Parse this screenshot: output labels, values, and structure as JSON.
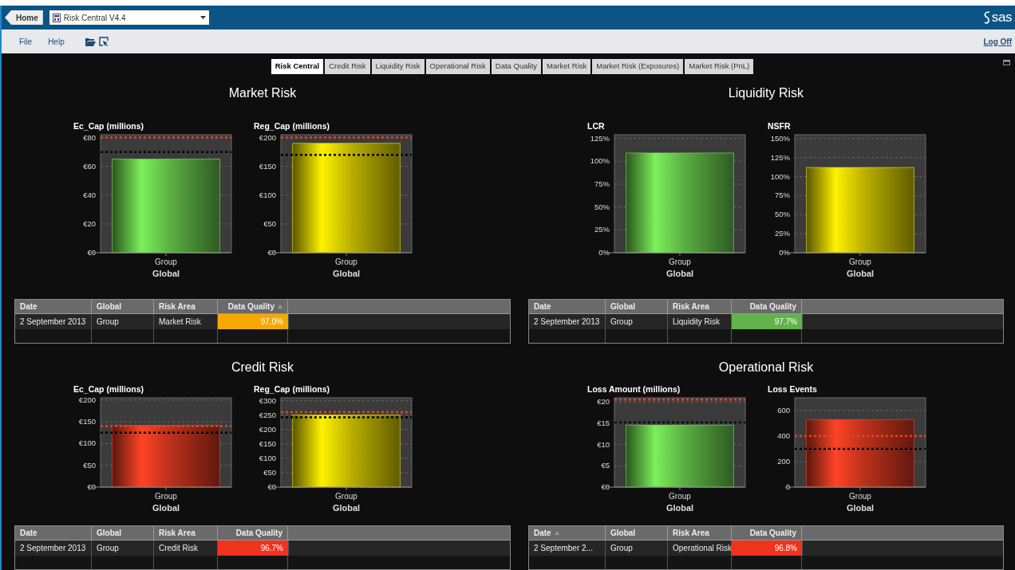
{
  "header": {
    "home": "Home",
    "app_selector": "Risk Central V4.4",
    "logo": "sas"
  },
  "menu": {
    "items": [
      "File",
      "Help"
    ],
    "log_off": "Log Off"
  },
  "tabs": [
    {
      "label": "Risk Central",
      "selected": true
    },
    {
      "label": "Credit Risk",
      "selected": false
    },
    {
      "label": "Liquidity Risk",
      "selected": false
    },
    {
      "label": "Operational Risk",
      "selected": false
    },
    {
      "label": "Data Quality",
      "selected": false
    },
    {
      "label": "Market Risk",
      "selected": false
    },
    {
      "label": "Market Risk (Exposures)",
      "selected": false
    },
    {
      "label": "Market Risk (PnL)",
      "selected": false
    }
  ],
  "panels": [
    {
      "title": "Market Risk",
      "charts": [
        {
          "chart_data": {
            "type": "bar",
            "title": "Ec_Cap (millions)",
            "xlabel": "Global",
            "categories": [
              "Group"
            ],
            "series": [
              {
                "color": "#7cf05a",
                "values": [
                  65
                ]
              }
            ],
            "ylim": [
              0,
              82
            ],
            "yticks": [
              {
                "value": 0,
                "label": "€0"
              },
              {
                "value": 20,
                "label": "€20"
              },
              {
                "value": 40,
                "label": "€40"
              },
              {
                "value": 60,
                "label": "€60"
              },
              {
                "value": 80,
                "label": "€80"
              }
            ],
            "grid": true,
            "ref_lines": [
              {
                "axis": "y",
                "value": 80,
                "color": "#e8432c"
              },
              {
                "axis": "y",
                "value": 70,
                "color": "#000000"
              }
            ]
          }
        },
        {
          "chart_data": {
            "type": "bar",
            "title": "Reg_Cap (millions)",
            "xlabel": "Global",
            "categories": [
              "Group"
            ],
            "series": [
              {
                "color": "#fff200",
                "values": [
                  190
                ]
              }
            ],
            "ylim": [
              0,
              205
            ],
            "yticks": [
              {
                "value": 0,
                "label": "€0"
              },
              {
                "value": 50,
                "label": "€50"
              },
              {
                "value": 100,
                "label": "€100"
              },
              {
                "value": 150,
                "label": "€150"
              },
              {
                "value": 200,
                "label": "€200"
              }
            ],
            "grid": true,
            "ref_lines": [
              {
                "axis": "y",
                "value": 200,
                "color": "#e8432c"
              },
              {
                "axis": "y",
                "value": 170,
                "color": "#000000"
              }
            ]
          }
        }
      ],
      "table": {
        "columns": [
          {
            "label": "Date",
            "kind": "text",
            "sorted": false
          },
          {
            "label": "Global",
            "kind": "text",
            "sorted": false
          },
          {
            "label": "Risk Area",
            "kind": "text",
            "sorted": false
          },
          {
            "label": "Data Quality",
            "kind": "quality",
            "sorted": true
          }
        ],
        "rows": [
          {
            "date": "2 September 2013",
            "global": "Group",
            "area": "Market Risk",
            "quality": "97.0%",
            "color": "#f5a800"
          }
        ]
      }
    },
    {
      "title": "Liquidity Risk",
      "charts": [
        {
          "chart_data": {
            "type": "bar",
            "title": "LCR",
            "xlabel": "Global",
            "categories": [
              "Group"
            ],
            "series": [
              {
                "color": "#7cf05a",
                "values": [
                  109
                ]
              }
            ],
            "ylim": [
              0,
              129
            ],
            "yticks": [
              {
                "value": 0,
                "label": "0%"
              },
              {
                "value": 25,
                "label": "25%"
              },
              {
                "value": 50,
                "label": "50%"
              },
              {
                "value": 75,
                "label": "75%"
              },
              {
                "value": 100,
                "label": "100%"
              },
              {
                "value": 125,
                "label": "125%"
              }
            ],
            "grid": true
          }
        },
        {
          "chart_data": {
            "type": "bar",
            "title": "NSFR",
            "xlabel": "Global",
            "categories": [
              "Group"
            ],
            "series": [
              {
                "color": "#fff200",
                "values": [
                  112
                ]
              }
            ],
            "ylim": [
              0,
              155
            ],
            "yticks": [
              {
                "value": 0,
                "label": "0%"
              },
              {
                "value": 25,
                "label": "25%"
              },
              {
                "value": 50,
                "label": "50%"
              },
              {
                "value": 75,
                "label": "75%"
              },
              {
                "value": 100,
                "label": "100%"
              },
              {
                "value": 125,
                "label": "125%"
              },
              {
                "value": 150,
                "label": "150%"
              }
            ],
            "grid": true
          }
        }
      ],
      "table": {
        "columns": [
          {
            "label": "Date",
            "kind": "text",
            "sorted": false
          },
          {
            "label": "Global",
            "kind": "text",
            "sorted": false
          },
          {
            "label": "Risk Area",
            "kind": "text",
            "sorted": false
          },
          {
            "label": "Data Quality",
            "kind": "quality",
            "sorted": false
          }
        ],
        "rows": [
          {
            "date": "2 September 2013",
            "global": "Group",
            "area": "Liquidity Risk",
            "quality": "97.7%",
            "color": "#62b34a"
          }
        ]
      }
    },
    {
      "title": "Credit Risk",
      "charts": [
        {
          "chart_data": {
            "type": "bar",
            "title": "Ec_Cap (millions)",
            "xlabel": "Global",
            "categories": [
              "Group"
            ],
            "series": [
              {
                "color": "#ff4326",
                "values": [
                  142
                ]
              }
            ],
            "ylim": [
              0,
              205
            ],
            "yticks": [
              {
                "value": 0,
                "label": "€0"
              },
              {
                "value": 50,
                "label": "€50"
              },
              {
                "value": 100,
                "label": "€100"
              },
              {
                "value": 150,
                "label": "€150"
              },
              {
                "value": 200,
                "label": "€200"
              }
            ],
            "grid": true,
            "ref_lines": [
              {
                "axis": "y",
                "value": 140,
                "color": "#e8432c"
              },
              {
                "axis": "y",
                "value": 125,
                "color": "#000000"
              }
            ]
          }
        },
        {
          "chart_data": {
            "type": "bar",
            "title": "Reg_Cap (millions)",
            "xlabel": "Global",
            "categories": [
              "Group"
            ],
            "series": [
              {
                "color": "#fff200",
                "values": [
                  250
                ]
              }
            ],
            "ylim": [
              0,
              310
            ],
            "yticks": [
              {
                "value": 0,
                "label": "€0"
              },
              {
                "value": 50,
                "label": "€50"
              },
              {
                "value": 100,
                "label": "€100"
              },
              {
                "value": 150,
                "label": "€150"
              },
              {
                "value": 200,
                "label": "€200"
              },
              {
                "value": 250,
                "label": "€250"
              },
              {
                "value": 300,
                "label": "€300"
              }
            ],
            "grid": true,
            "ref_lines": [
              {
                "axis": "y",
                "value": 260,
                "color": "#e8432c"
              },
              {
                "axis": "y",
                "value": 242,
                "color": "#000000"
              }
            ]
          }
        }
      ],
      "table": {
        "columns": [
          {
            "label": "Date",
            "kind": "text",
            "sorted": false
          },
          {
            "label": "Global",
            "kind": "text",
            "sorted": false
          },
          {
            "label": "Risk Area",
            "kind": "text",
            "sorted": false
          },
          {
            "label": "Data Quality",
            "kind": "quality",
            "sorted": false
          }
        ],
        "rows": [
          {
            "date": "2 September 2013",
            "global": "Group",
            "area": "Credit Risk",
            "quality": "96.7%",
            "color": "#f0321e"
          }
        ]
      }
    },
    {
      "title": "Operational Risk",
      "charts": [
        {
          "chart_data": {
            "type": "bar",
            "title": "Loss Amount (millions)",
            "xlabel": "Global",
            "categories": [
              "Group"
            ],
            "series": [
              {
                "color": "#7cf05a",
                "values": [
                  14.6
                ]
              }
            ],
            "ylim": [
              0,
              21
            ],
            "yticks": [
              {
                "value": 0,
                "label": "€0"
              },
              {
                "value": 5,
                "label": "€5"
              },
              {
                "value": 10,
                "label": "€10"
              },
              {
                "value": 15,
                "label": "€15"
              },
              {
                "value": 20,
                "label": "€20"
              }
            ],
            "grid": true,
            "ref_lines": [
              {
                "axis": "y",
                "value": 20.6,
                "color": "#e8432c"
              },
              {
                "axis": "y",
                "value": 15.2,
                "color": "#000000"
              }
            ]
          }
        },
        {
          "chart_data": {
            "type": "bar",
            "title": "Loss Events",
            "xlabel": "Global",
            "categories": [
              "Group"
            ],
            "series": [
              {
                "color": "#ff4326",
                "values": [
                  530
                ]
              }
            ],
            "ylim": [
              0,
              700
            ],
            "yticks": [
              0,
              200,
              400,
              600
            ],
            "grid": true,
            "ref_lines": [
              {
                "axis": "y",
                "value": 400,
                "color": "#e8432c"
              },
              {
                "axis": "y",
                "value": 300,
                "color": "#000000"
              }
            ]
          }
        }
      ],
      "table": {
        "columns": [
          {
            "label": "Date",
            "kind": "text",
            "sorted": true
          },
          {
            "label": "Global",
            "kind": "text",
            "sorted": false
          },
          {
            "label": "Risk Area",
            "kind": "text",
            "sorted": false
          },
          {
            "label": "Data Quality",
            "kind": "quality",
            "sorted": false
          }
        ],
        "rows": [
          {
            "date": "2 September 2...",
            "global": "Group",
            "area": "Operational Risk",
            "quality": "96.8%",
            "color": "#f0321e"
          }
        ]
      }
    }
  ]
}
